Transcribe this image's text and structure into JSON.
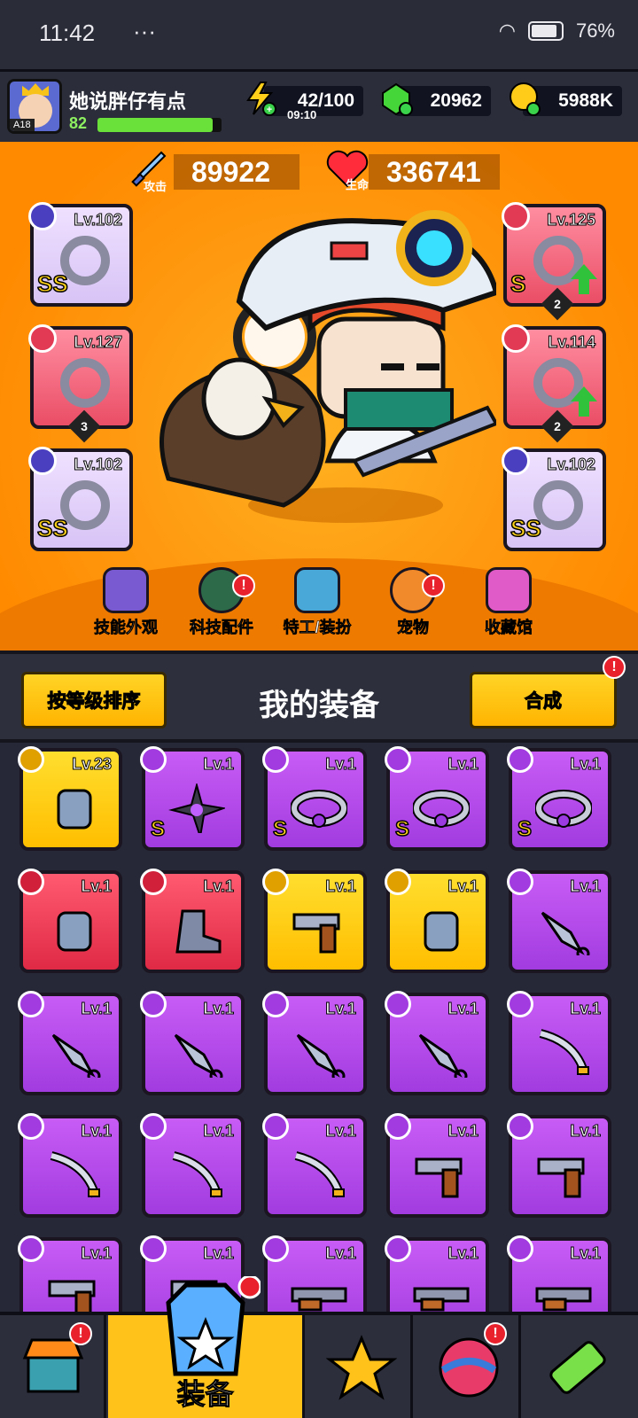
{
  "status_bar": {
    "time": "11:42",
    "dots": "···",
    "battery": "76%"
  },
  "player": {
    "name": "她说胖仔有点",
    "level": "82",
    "avatar_tag": "A18",
    "xp_fraction": 0.93
  },
  "resources": {
    "energy": {
      "value": "42/100",
      "timer": "09:10"
    },
    "gems": {
      "value": "20962"
    },
    "coins": {
      "value": "5988K"
    }
  },
  "stats": {
    "attack": {
      "value": "89922",
      "label": "攻击"
    },
    "hp": {
      "value": "336741",
      "label": "生命"
    }
  },
  "equipped": [
    {
      "level": "Lv.102",
      "rarity": "SS",
      "color": "purple",
      "icon": "weapon-staff-icon"
    },
    {
      "level": "Lv.125",
      "rarity": "S",
      "color": "red",
      "stars": "2",
      "upgrade": true,
      "icon": "armor-icon"
    },
    {
      "level": "Lv.127",
      "color": "red",
      "stars": "3",
      "icon": "necklace-icon"
    },
    {
      "level": "Lv.114",
      "color": "red",
      "stars": "2",
      "upgrade": true,
      "icon": "belt-icon"
    },
    {
      "level": "Lv.102",
      "rarity": "SS",
      "color": "purple",
      "icon": "gloves-icon"
    },
    {
      "level": "Lv.102",
      "rarity": "SS",
      "color": "purple",
      "icon": "boots-icon"
    }
  ],
  "feature_menu": [
    {
      "label": "技能外观",
      "badge": false
    },
    {
      "label": "科技配件",
      "badge": true
    },
    {
      "label": "特工/装扮",
      "badge": false
    },
    {
      "label": "宠物",
      "badge": true
    },
    {
      "label": "收藏馆",
      "badge": false
    }
  ],
  "gear_section": {
    "sort_button": "按等级排序",
    "title": "我的装备",
    "merge_button": "合成",
    "badge": "!"
  },
  "inventory": [
    {
      "level": "Lv.23",
      "color": "y",
      "icon": "gloves-icon"
    },
    {
      "level": "Lv.1",
      "color": "p",
      "rarity": "S",
      "icon": "shuriken-icon"
    },
    {
      "level": "Lv.1",
      "color": "p",
      "rarity": "S",
      "icon": "belt-icon"
    },
    {
      "level": "Lv.1",
      "color": "p",
      "rarity": "S",
      "icon": "belt-icon"
    },
    {
      "level": "Lv.1",
      "color": "p",
      "rarity": "S",
      "icon": "belt-icon"
    },
    {
      "level": "Lv.1",
      "color": "r",
      "icon": "gloves-icon"
    },
    {
      "level": "Lv.1",
      "color": "r",
      "icon": "boots-icon"
    },
    {
      "level": "Lv.1",
      "color": "y",
      "icon": "revolver-icon"
    },
    {
      "level": "Lv.1",
      "color": "y",
      "icon": "gloves-icon"
    },
    {
      "level": "Lv.1",
      "color": "p",
      "icon": "kunai-icon"
    },
    {
      "level": "Lv.1",
      "color": "p",
      "icon": "kunai-icon"
    },
    {
      "level": "Lv.1",
      "color": "p",
      "icon": "kunai-icon"
    },
    {
      "level": "Lv.1",
      "color": "p",
      "icon": "kunai-icon"
    },
    {
      "level": "Lv.1",
      "color": "p",
      "icon": "kunai-icon"
    },
    {
      "level": "Lv.1",
      "color": "p",
      "icon": "katana-icon"
    },
    {
      "level": "Lv.1",
      "color": "p",
      "icon": "katana-icon"
    },
    {
      "level": "Lv.1",
      "color": "p",
      "icon": "katana-icon"
    },
    {
      "level": "Lv.1",
      "color": "p",
      "icon": "katana-icon"
    },
    {
      "level": "Lv.1",
      "color": "p",
      "icon": "revolver-icon"
    },
    {
      "level": "Lv.1",
      "color": "p",
      "icon": "revolver-icon"
    },
    {
      "level": "Lv.1",
      "color": "p",
      "icon": "revolver-icon"
    },
    {
      "level": "Lv.1",
      "color": "p",
      "icon": "revolver-icon"
    },
    {
      "level": "Lv.1",
      "color": "p",
      "icon": "rifle-icon"
    },
    {
      "level": "Lv.1",
      "color": "p",
      "icon": "rifle-icon"
    },
    {
      "level": "Lv.1",
      "color": "p",
      "icon": "rifle-icon"
    }
  ],
  "bottom_nav": {
    "active_label": "装备"
  },
  "colors": {
    "accent": "#ffc21a",
    "background": "#2b2d3a",
    "hero_bg": "#ff9a10"
  }
}
